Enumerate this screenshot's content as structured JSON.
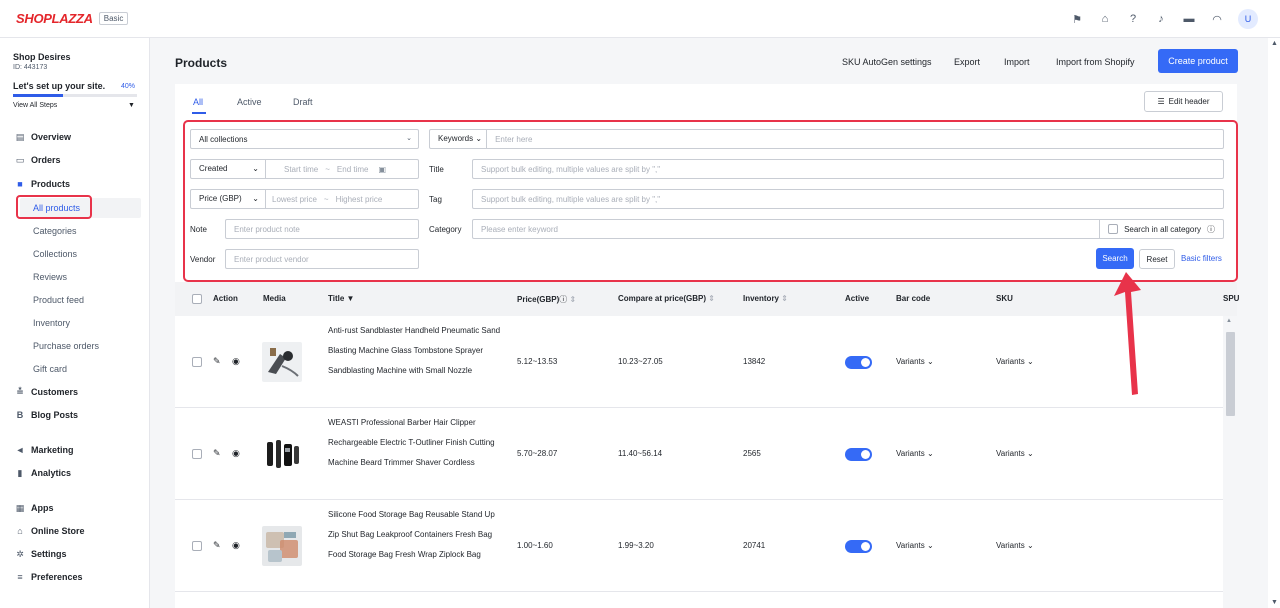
{
  "brand": {
    "name": "SHOPLAZZA",
    "plan": "Basic"
  },
  "user": {
    "initial": "U"
  },
  "sidebar": {
    "shop_name": "Shop Desires",
    "shop_id": "ID: 443173",
    "setup_text": "Let's set up your site.",
    "setup_percent": "40%",
    "setup_progress": 0.4,
    "view_steps": "View All Steps",
    "items": [
      {
        "label": "Overview",
        "icon": "overview-icon"
      },
      {
        "label": "Orders",
        "icon": "orders-icon"
      },
      {
        "label": "Products",
        "icon": "products-icon"
      },
      {
        "label": "Customers",
        "icon": "customers-icon"
      },
      {
        "label": "Blog Posts",
        "icon": "blog-icon"
      },
      {
        "label": "Marketing",
        "icon": "marketing-icon"
      },
      {
        "label": "Analytics",
        "icon": "analytics-icon"
      },
      {
        "label": "Apps",
        "icon": "apps-icon"
      },
      {
        "label": "Online Store",
        "icon": "store-icon"
      },
      {
        "label": "Settings",
        "icon": "gear-icon"
      },
      {
        "label": "Preferences",
        "icon": "preferences-icon"
      }
    ],
    "product_subitems": [
      "All products",
      "Categories",
      "Collections",
      "Reviews",
      "Product feed",
      "Inventory",
      "Purchase orders",
      "Gift card"
    ]
  },
  "header": {
    "title": "Products",
    "actions": [
      "SKU AutoGen settings",
      "Export",
      "Import",
      "Import from Shopify"
    ],
    "create_label": "Create product"
  },
  "tabs": [
    "All",
    "Active",
    "Draft"
  ],
  "edit_header_label": "Edit header",
  "filters": {
    "collections": "All collections",
    "keywords_label": "Keywords",
    "keywords_placeholder": "Enter here",
    "created": "Created",
    "start_time": "Start time",
    "end_time": "End time",
    "title_label": "Title",
    "title_placeholder": "Support bulk editing, multiple values are split by \",\"",
    "price": "Price (GBP)",
    "lowest_price": "Lowest price",
    "highest_price": "Highest price",
    "tag_label": "Tag",
    "tag_placeholder": "Support bulk editing, multiple values are split by \",\"",
    "note_label": "Note",
    "note_placeholder": "Enter product note",
    "category_label": "Category",
    "category_placeholder": "Please enter keyword",
    "search_all_category": "Search in all category",
    "vendor_label": "Vendor",
    "vendor_placeholder": "Enter product vendor",
    "search_label": "Search",
    "reset_label": "Reset",
    "basic_filters_label": "Basic filters"
  },
  "table": {
    "columns": [
      "Action",
      "Media",
      "Title",
      "Price(GBP)",
      "Compare at price(GBP)",
      "Inventory",
      "Active",
      "Bar code",
      "SKU",
      "SPU"
    ],
    "rows": [
      {
        "title": "Anti-rust Sandblaster Handheld Pneumatic Sand Blasting Machine Glass Tombstone Sprayer Sandblasting Machine with Small Nozzle",
        "price": "5.12~13.53",
        "compare": "10.23~27.05",
        "inventory": "13842",
        "barcode": "Variants",
        "sku": "Variants"
      },
      {
        "title": "WEASTI Professional Barber Hair Clipper Rechargeable Electric T-Outliner Finish Cutting Machine Beard Trimmer Shaver Cordless",
        "price": "5.70~28.07",
        "compare": "11.40~56.14",
        "inventory": "2565",
        "barcode": "Variants",
        "sku": "Variants"
      },
      {
        "title": "Silicone Food Storage Bag Reusable Stand Up Zip Shut Bag Leakproof Containers Fresh Bag Food Storage Bag Fresh Wrap Ziplock Bag",
        "price": "1.00~1.60",
        "compare": "1.99~3.20",
        "inventory": "20741",
        "barcode": "Variants",
        "sku": "Variants"
      }
    ]
  },
  "colors": {
    "accent": "#356af6",
    "highlight": "#e8334a",
    "brand": "#e4262b"
  }
}
